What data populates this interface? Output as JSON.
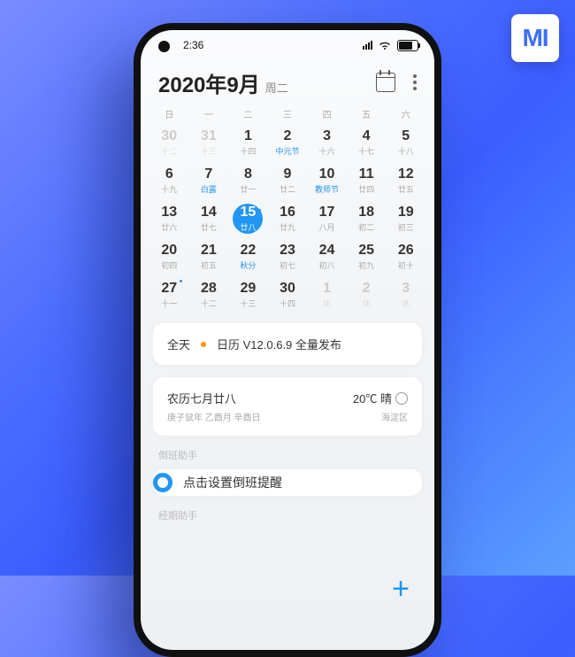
{
  "status": {
    "time": "2:36"
  },
  "logo": "MI",
  "header": {
    "title": "2020年9月",
    "sub": "周二"
  },
  "weekdays": [
    "日",
    "一",
    "二",
    "三",
    "四",
    "五",
    "六"
  ],
  "weeks": [
    [
      {
        "n": "30",
        "s": "十二",
        "dim": 1
      },
      {
        "n": "31",
        "s": "十三",
        "dim": 1
      },
      {
        "n": "1",
        "s": "十四"
      },
      {
        "n": "2",
        "s": "中元节",
        "hl": 1
      },
      {
        "n": "3",
        "s": "十六"
      },
      {
        "n": "4",
        "s": "十七"
      },
      {
        "n": "5",
        "s": "十八"
      }
    ],
    [
      {
        "n": "6",
        "s": "十九"
      },
      {
        "n": "7",
        "s": "白露",
        "hl": 1
      },
      {
        "n": "8",
        "s": "廿一"
      },
      {
        "n": "9",
        "s": "廿二"
      },
      {
        "n": "10",
        "s": "教师节",
        "hl": 1
      },
      {
        "n": "11",
        "s": "廿四"
      },
      {
        "n": "12",
        "s": "廿五"
      }
    ],
    [
      {
        "n": "13",
        "s": "廿六"
      },
      {
        "n": "14",
        "s": "廿七"
      },
      {
        "n": "15",
        "s": "廿八",
        "today": 1,
        "mark": 1
      },
      {
        "n": "16",
        "s": "廿九"
      },
      {
        "n": "17",
        "s": "八月"
      },
      {
        "n": "18",
        "s": "初二"
      },
      {
        "n": "19",
        "s": "初三"
      }
    ],
    [
      {
        "n": "20",
        "s": "初四"
      },
      {
        "n": "21",
        "s": "初五"
      },
      {
        "n": "22",
        "s": "秋分",
        "hl": 1
      },
      {
        "n": "23",
        "s": "初七"
      },
      {
        "n": "24",
        "s": "初八"
      },
      {
        "n": "25",
        "s": "初九"
      },
      {
        "n": "26",
        "s": "初十"
      }
    ],
    [
      {
        "n": "27",
        "s": "十一",
        "mark": 1
      },
      {
        "n": "28",
        "s": "十二"
      },
      {
        "n": "29",
        "s": "十三"
      },
      {
        "n": "30",
        "s": "十四"
      },
      {
        "n": "1",
        "s": "休",
        "dim": 1
      },
      {
        "n": "2",
        "s": "休",
        "dim": 1
      },
      {
        "n": "3",
        "s": "休",
        "dim": 1
      }
    ]
  ],
  "event": {
    "time": "全天",
    "text": "日历 V12.0.6.9 全量发布"
  },
  "weather": {
    "lunar": "农历七月廿八",
    "ganzhi": "庚子鼠年 乙酉月 辛酉日",
    "temp": "20℃ 晴",
    "loc": "海淀区"
  },
  "shift": {
    "header": "倒班助手",
    "text": "点击设置倒班提醒"
  },
  "footer": "经期助手"
}
